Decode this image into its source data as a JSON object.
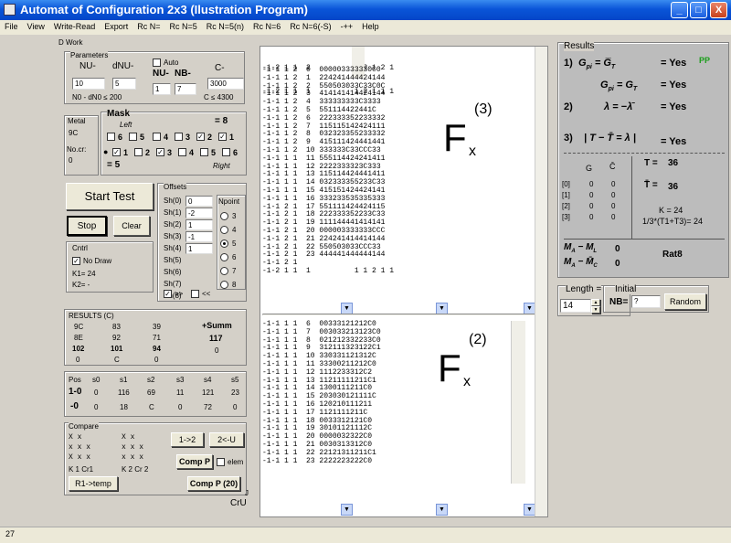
{
  "window": {
    "title": "Automat of Configuration 2x3 (Ilustration Program)"
  },
  "window_buttons": {
    "minimize": "_",
    "maximize": "□",
    "close": "X"
  },
  "menu": [
    "File",
    "View",
    "Write-Read",
    "Export",
    "Rc N=",
    "Rc N=5",
    "Rc N=5(n)",
    "Rc N=6",
    "Rc N=6(-S)",
    "-++",
    "Help"
  ],
  "dwork": "D Work",
  "params": {
    "legend": "Parameters",
    "nu_label": "NU-",
    "dnu_label": "dNU-",
    "nu_value": "10",
    "dnu_value": "5",
    "auto_label": "Auto",
    "nu_n_label": "NU-",
    "nb_label": "NB-",
    "c_label": "C-",
    "nu_n_value": "1",
    "nb_value": "7",
    "c_value": "3000",
    "formula": "N0 - dN0 ≤ 200",
    "c_result": "C ≤ 4300"
  },
  "metal": {
    "legend": "Metal",
    "label1": "9C",
    "label2": "No.cr:",
    "value2": "0"
  },
  "mask": {
    "legend": "Mask",
    "left_label": "Left",
    "right_label": "Right",
    "eq8": "= 8",
    "eq5": "= 5",
    "row1": [
      {
        "n": "6",
        "c": false
      },
      {
        "n": "5",
        "c": false
      },
      {
        "n": "4",
        "c": false
      },
      {
        "n": "3",
        "c": false
      },
      {
        "n": "2",
        "c": true
      },
      {
        "n": "1",
        "c": true
      }
    ],
    "row2": [
      {
        "n": "1",
        "c": true
      },
      {
        "n": "2",
        "c": false
      },
      {
        "n": "3",
        "c": true
      },
      {
        "n": "4",
        "c": false
      },
      {
        "n": "5",
        "c": false
      },
      {
        "n": "6",
        "c": false
      }
    ]
  },
  "start_test": "Start Test",
  "stop": "Stop",
  "clear": "Clear",
  "offsets": {
    "legend": "Offsets",
    "labels": [
      "Sh(0)",
      "Sh(1)",
      "Sh(2)",
      "Sh(3)",
      "Sh(4)",
      "Sh(5)",
      "Sh(6)",
      "Sh(7)",
      "Sh(8)"
    ],
    "values": [
      "0",
      "-2",
      "1",
      "-1",
      "1"
    ],
    "chk1": ">>",
    "chk2": "<<"
  },
  "npoint": {
    "legend": "Npoint",
    "options": [
      "3",
      "4",
      "5",
      "6",
      "7",
      "8"
    ],
    "selected": "5"
  },
  "cntrl": {
    "legend": "Cntrl",
    "no_draw": "No Draw",
    "k1": "K1= 24",
    "k2": "K2= -"
  },
  "results_left": {
    "legend": "RESULTS (C)",
    "rows": [
      [
        "9C",
        "83",
        "39"
      ],
      [
        "8E",
        "92",
        "71"
      ],
      [
        "102",
        "101",
        "94"
      ],
      [
        "0",
        "C",
        "0"
      ]
    ],
    "summ_label": "+Summ",
    "summ_value": "117",
    "summ_extra": "0"
  },
  "pos": {
    "headers": [
      "Pos",
      "s0",
      "s1",
      "s2",
      "s3",
      "s4",
      "s5"
    ],
    "row1": [
      "1-0",
      "0",
      "116",
      "69",
      "11",
      "121",
      "23"
    ],
    "row2": [
      "-0",
      "0",
      "18",
      "C",
      "0",
      "72",
      "0"
    ]
  },
  "compare": {
    "legend": "Compare",
    "b1": "1->2",
    "b2": "2<-U",
    "comp_p": "Comp P",
    "elem": "elem",
    "b_temp": "R1->temp",
    "comp_p20": "Comp P (20)",
    "k1": "K 1 Cr1",
    "k2": "K 2 Cr 2",
    "cru": "CrU",
    "j": "J"
  },
  "grid": {
    "top_rows": [
      "-1-2 1 1  2          1 2 1 2 1",
      "-1-2 1 1  1          1 2 1 1 1"
    ],
    "f3": [
      "-1-1 1 2  0  000003333330C0",
      "-1-1 1 2  1  224241444424144",
      "-1-1 1 2  2  550503033C33C0C",
      "-1-1 1 2  3  414141414424144",
      "-1-1 1 2  4  333333333C3333",
      "-1-1 1 2  5  551114422441C",
      "-1-1 1 2  6  222333352233332",
      "-1-1 1 2  7  115115142424111",
      "-1-1 1 2  8  032323355233332",
      "-1-1 1 2  9  415111424441441",
      "-1-1 1 2  10 333333C33CCC33",
      "-1-1 1 1  11 555114424241411",
      "-1-1 1 1  12 2222333323C333",
      "-1-1 1 1  13 115114424441411",
      "-1-1 1 1  14 032333355233C33",
      "-1-1 1 1  15 415151424424141",
      "-1-1 1 1  16 333233535335333",
      "-1-1 2 1  17 551111424424115",
      "-1-1 2 1  18 222333352233C33",
      "-1-1 2 1  19 111144441414141",
      "-1-1 2 1  20 000003333333CCC",
      "-1-1 2 1  21 224241414414144",
      "-1-1 2 1  22 550503033CCC33",
      "-1-1 2 1  23 444441444444144",
      "-1-1 2 1",
      "-1-2 1 1  1          1 1 2 1 1"
    ],
    "f2": [
      "-1-1 1 1  6  00333121212C0",
      "-1-1 1 1  7  003033213123C0",
      "-1-1 1 1  8  021212332233C0",
      "-1-1 1 1  9  312111323122C1",
      "-1-1 1 1  10 330331121312C",
      "-1-1 1 1  11 33300211212C0",
      "-1-1 1 1  12 1112233312C2",
      "-1-1 1 1  13 11211111211C1",
      "-1-1 1 1  14 1300111211C0",
      "-1-1 1 1  15 203030121111C",
      "-1-1 1 1  16 120210111211",
      "-1-1 1 1  17 1121111211C",
      "-1-1 1 1  18 0033312121C0",
      "-1-1 1 1  19 30101121112C",
      "-1-1 1 1  20 0000032322C0",
      "-1-1 1 1  21 0030313312C0",
      "-1-1 1 1  22 22121311211C1",
      "-1-1 1 1  23 2222223222C0"
    ],
    "f3_label": "F",
    "f3_sub": "x",
    "f3_sup": "(3)",
    "f2_label": "F",
    "f2_sub": "x",
    "f2_sup": "(2)"
  },
  "results": {
    "legend": "Results",
    "r1": "1)",
    "r1_eq": "= Yes",
    "r1_pp": "PP",
    "r1b_eq": "= Yes",
    "r2": "2)",
    "r2_eq": "= Yes",
    "r3": "3)",
    "r3_eq": "= Yes",
    "t_label": "T =",
    "t_value": "36",
    "tbar_label": "T̄ =",
    "tbar_value": "36",
    "g_header": "G",
    "c_header": "C̄",
    "rows": [
      [
        "[0]",
        "0",
        "0"
      ],
      [
        "[1]",
        "0",
        "0"
      ],
      [
        "[2]",
        "0",
        "0"
      ],
      [
        "[3]",
        "0",
        "0"
      ]
    ],
    "k_label": "K = 24",
    "k_formula": "1/3*(T1+T3)= 24",
    "rat": "Rat8",
    "m_val1": "0",
    "m_val2": "0"
  },
  "length": {
    "legend": "Length =",
    "value": "14",
    "initial_legend": "Initial",
    "nb_label": "NB=",
    "nb_value": "?",
    "random": "Random"
  },
  "status": "27"
}
